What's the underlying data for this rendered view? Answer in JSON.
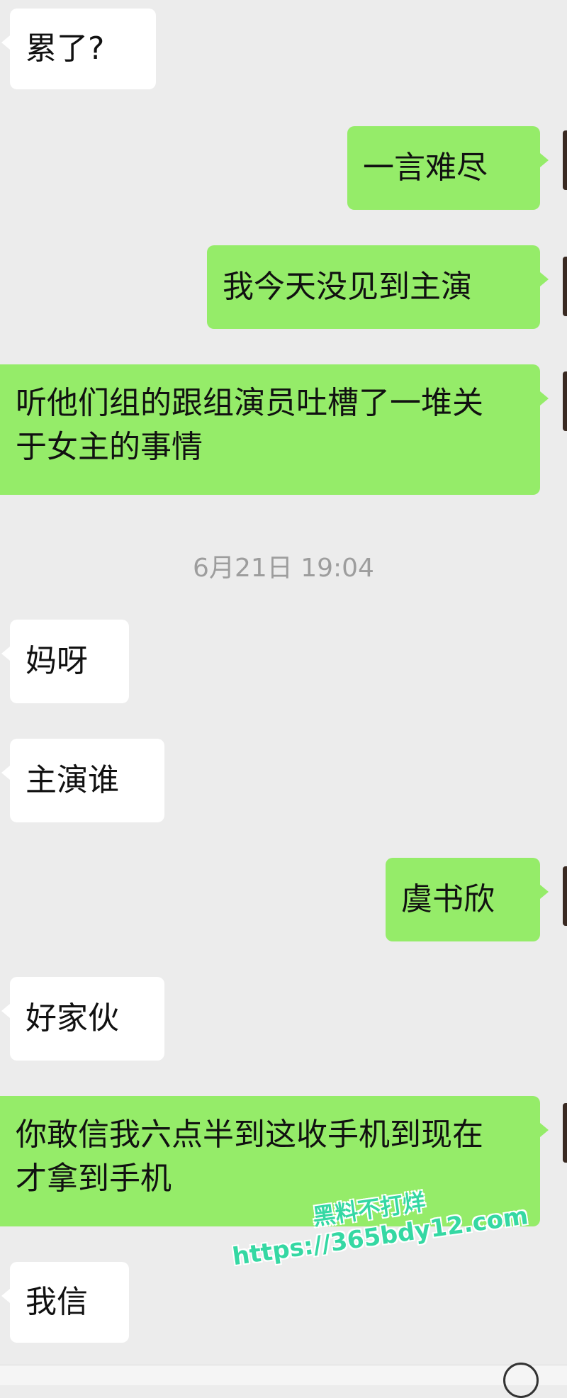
{
  "messages": [
    {
      "direction": "incoming",
      "text": "累了?"
    },
    {
      "direction": "outgoing",
      "text": "一言难尽"
    },
    {
      "direction": "outgoing",
      "text": "我今天没见到主演"
    },
    {
      "direction": "outgoing",
      "text": "听他们组的跟组演员吐槽了一堆关于女主的事情"
    },
    {
      "direction": "incoming",
      "text": "妈呀"
    },
    {
      "direction": "incoming",
      "text": "主演谁"
    },
    {
      "direction": "outgoing",
      "text": "虞书欣"
    },
    {
      "direction": "incoming",
      "text": "好家伙"
    },
    {
      "direction": "outgoing",
      "text": "你敢信我六点半到这收手机到现在才拿到手机"
    },
    {
      "direction": "incoming",
      "text": "我信"
    }
  ],
  "timestamp": "6月21日 19:04",
  "watermark": {
    "line1": "黑料不打烊",
    "line2": "https://365bdy12.com"
  },
  "colors": {
    "outgoing_bubble": "#95ec69",
    "incoming_bubble": "#ffffff",
    "background": "#ececec",
    "timestamp": "#9d9d9d",
    "watermark": "#35d8a3"
  }
}
